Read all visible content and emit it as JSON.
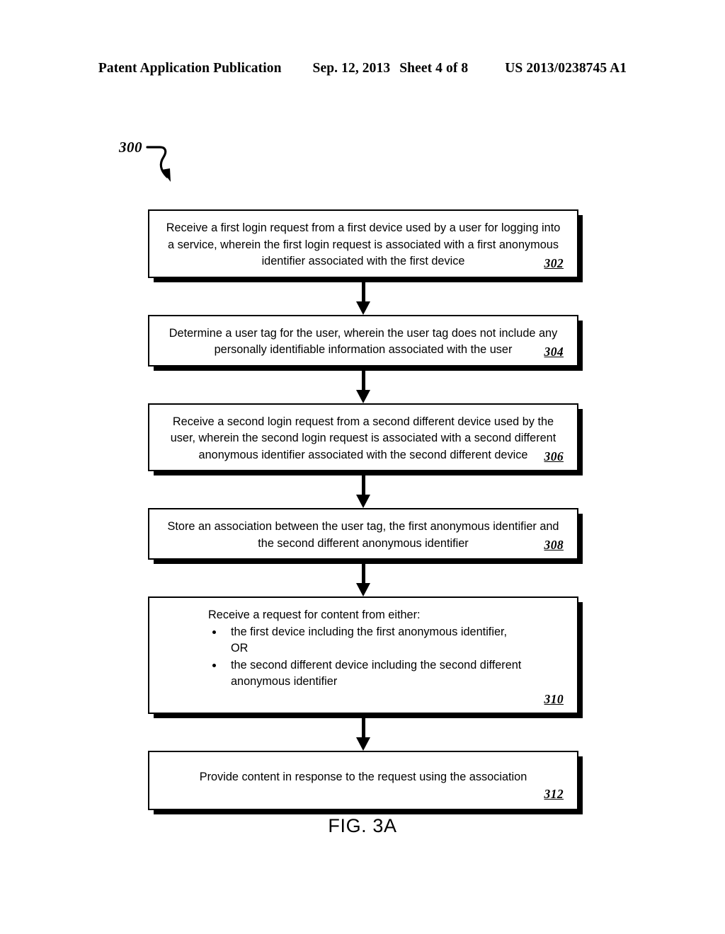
{
  "header": {
    "publication": "Patent Application Publication",
    "date": "Sep. 12, 2013",
    "sheet": "Sheet 4 of 8",
    "patent_number": "US 2013/0238745 A1"
  },
  "figure": {
    "reference_label": "300",
    "caption": "FIG. 3A"
  },
  "flow": {
    "nodes": [
      {
        "id": "302",
        "text": "Receive a first login request from a first device used by a user for logging into a service, wherein the first login request is associated with a first anonymous identifier associated with the first device",
        "number": "302",
        "align": "center"
      },
      {
        "id": "304",
        "text": "Determine a user tag for the user, wherein the user tag does not include any personally identifiable information associated with the user",
        "number": "304",
        "align": "center"
      },
      {
        "id": "306",
        "text": "Receive a second login request from a second different device used by the user, wherein the second login request is associated with a second different anonymous identifier associated with the second different device",
        "number": "306",
        "align": "center"
      },
      {
        "id": "308",
        "text": "Store an association between the user tag, the first anonymous identifier and the second different anonymous identifier",
        "number": "308",
        "align": "center"
      },
      {
        "id": "310",
        "lead_text": "Receive a request for content from either:",
        "bullets": [
          "the first device including the first anonymous identifier,",
          "OR",
          "the second different device including the second different anonymous identifier"
        ],
        "number": "310",
        "align": "left"
      },
      {
        "id": "312",
        "text": "Provide content in response to the request using the association",
        "number": "312",
        "align": "center"
      }
    ]
  }
}
